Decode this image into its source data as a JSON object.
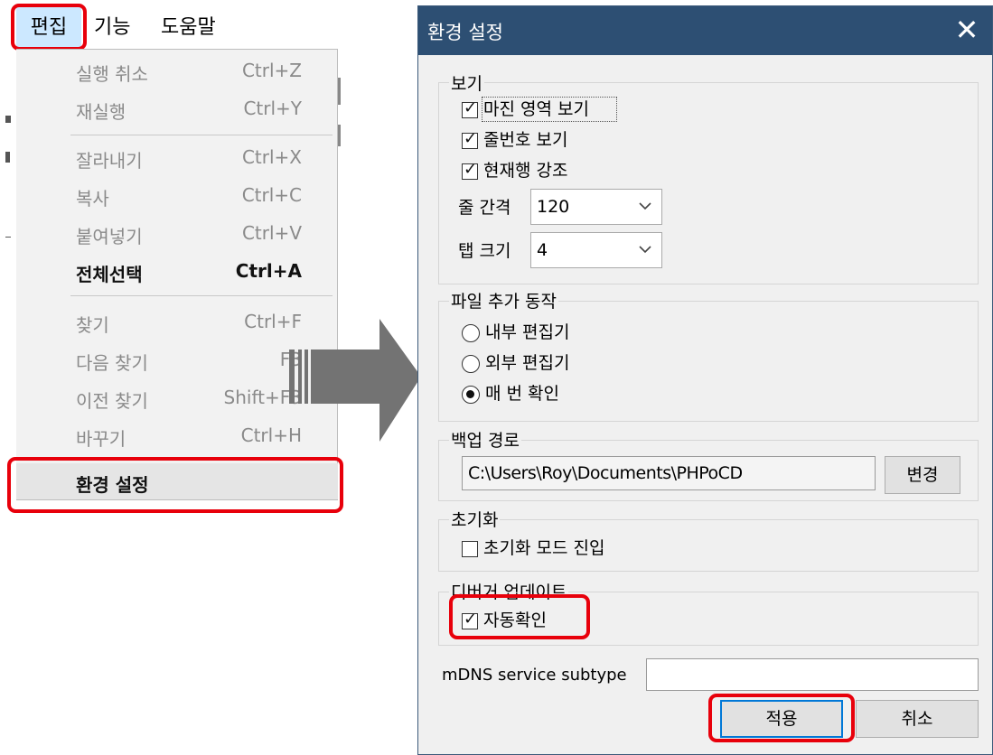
{
  "menubar": {
    "items": [
      "편집",
      "기능",
      "도움말"
    ]
  },
  "edit_menu": {
    "items": [
      {
        "label": "실행 취소",
        "shortcut": "Ctrl+Z",
        "state": "disabled"
      },
      {
        "label": "재실행",
        "shortcut": "Ctrl+Y",
        "state": "disabled"
      },
      {
        "label": "잘라내기",
        "shortcut": "Ctrl+X",
        "state": "disabled"
      },
      {
        "label": "복사",
        "shortcut": "Ctrl+C",
        "state": "disabled"
      },
      {
        "label": "붙여넣기",
        "shortcut": "Ctrl+V",
        "state": "disabled"
      },
      {
        "label": "전체선택",
        "shortcut": "Ctrl+A",
        "state": "enabled"
      },
      {
        "label": "찾기",
        "shortcut": "Ctrl+F",
        "state": "disabled"
      },
      {
        "label": "다음 찾기",
        "shortcut": "F3",
        "state": "disabled"
      },
      {
        "label": "이전 찾기",
        "shortcut": "Shift+F3",
        "state": "disabled"
      },
      {
        "label": "바꾸기",
        "shortcut": "Ctrl+H",
        "state": "disabled"
      },
      {
        "label": "환경 설정",
        "shortcut": "",
        "state": "highlighted"
      }
    ]
  },
  "dialog": {
    "title": "환경 설정",
    "close_glyph": "✕",
    "view_group": {
      "label": "보기",
      "show_margin": {
        "label": "마진 영역 보기",
        "checked": true
      },
      "show_line_numbers": {
        "label": "줄번호 보기",
        "checked": true
      },
      "highlight_current_line": {
        "label": "현재행 강조",
        "checked": true
      },
      "line_spacing": {
        "label": "줄 간격",
        "value": "120"
      },
      "tab_size": {
        "label": "탭 크기",
        "value": "4"
      }
    },
    "file_add_group": {
      "label": "파일 추가 동작",
      "options": [
        {
          "label": "내부 편집기",
          "selected": false
        },
        {
          "label": "외부 편집기",
          "selected": false
        },
        {
          "label": "매 번 확인",
          "selected": true
        }
      ]
    },
    "backup_group": {
      "label": "백업 경로",
      "path": "C:\\Users\\Roy\\Documents\\PHPoCD",
      "change_button": "변경"
    },
    "reset_group": {
      "label": "초기화",
      "enter_reset_mode": {
        "label": "초기화 모드 진입",
        "checked": false
      }
    },
    "debugger_group": {
      "label": "디버거 업데이트",
      "auto_check": {
        "label": "자동확인",
        "checked": true
      }
    },
    "mdns": {
      "label": "mDNS service subtype",
      "value": ""
    },
    "apply_button": "적용",
    "cancel_button": "취소"
  },
  "colors": {
    "highlight_ring": "#e8000b",
    "titlebar": "#2d4f73",
    "arrow": "#737373",
    "menu_selected_bg": "#cce8ff"
  },
  "icons": {
    "checkmark": "check-icon",
    "close": "close-icon",
    "dropdown": "chevron-down-icon",
    "arrow": "right-arrow-icon"
  }
}
